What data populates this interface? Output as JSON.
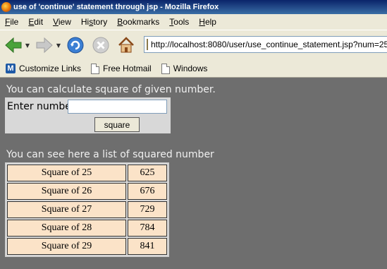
{
  "window": {
    "title": "use of 'continue' statement through jsp - Mozilla Firefox"
  },
  "menu": {
    "items": [
      {
        "pre": "",
        "u": "F",
        "post": "ile"
      },
      {
        "pre": "",
        "u": "E",
        "post": "dit"
      },
      {
        "pre": "",
        "u": "V",
        "post": "iew"
      },
      {
        "pre": "Hi",
        "u": "s",
        "post": "tory"
      },
      {
        "pre": "",
        "u": "B",
        "post": "ookmarks"
      },
      {
        "pre": "",
        "u": "T",
        "post": "ools"
      },
      {
        "pre": "",
        "u": "H",
        "post": "elp"
      }
    ]
  },
  "address": {
    "url": "http://localhost:8080/user/use_continue_statement.jsp?num=25"
  },
  "bookmarks": {
    "items": [
      "Customize Links",
      "Free Hotmail",
      "Windows"
    ]
  },
  "page": {
    "intro": "You can calculate square of given number.",
    "input_label": "Enter number",
    "input_value": "",
    "button_label": "square",
    "list_heading": "You can see here a list of squared number",
    "rows": [
      {
        "label": "Square of 25",
        "value": "625"
      },
      {
        "label": "Square of 26",
        "value": "676"
      },
      {
        "label": "Square of 27",
        "value": "729"
      },
      {
        "label": "Square of 28",
        "value": "784"
      },
      {
        "label": "Square of 29",
        "value": "841"
      }
    ]
  },
  "colors": {
    "page_bg": "#6e6e6e",
    "form_bg": "#d8d8d8",
    "cell_bg": "#fbe3c8",
    "chrome_bg": "#ece9d8"
  }
}
